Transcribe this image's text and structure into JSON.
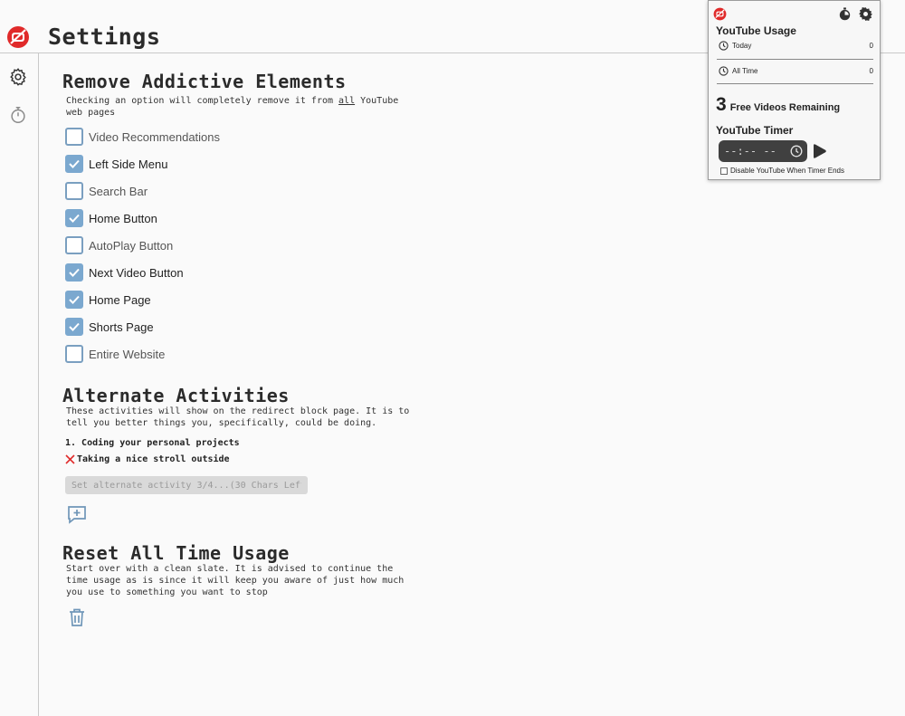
{
  "header": {
    "title": "Settings"
  },
  "colors": {
    "brand_red": "#e02a2a",
    "checkbox_blue": "#7ba8cf",
    "accent_icon": "#6f96b8"
  },
  "sidebar": {
    "items": [
      {
        "icon": "gear-icon"
      },
      {
        "icon": "stopwatch-icon"
      }
    ]
  },
  "remove": {
    "title": "Remove Addictive Elements",
    "desc_before": "Checking an option will completely remove it from ",
    "desc_emphasis": "all",
    "desc_after": " YouTube web pages",
    "options": [
      {
        "label": "Video Recommendations",
        "checked": false
      },
      {
        "label": "Left Side Menu",
        "checked": true
      },
      {
        "label": "Search Bar",
        "checked": false
      },
      {
        "label": "Home Button",
        "checked": true
      },
      {
        "label": "AutoPlay Button",
        "checked": false
      },
      {
        "label": "Next Video Button",
        "checked": true
      },
      {
        "label": "Home Page",
        "checked": true
      },
      {
        "label": "Shorts Page",
        "checked": true
      },
      {
        "label": "Entire Website",
        "checked": false
      }
    ]
  },
  "alternate": {
    "title": "Alternate Activities",
    "desc": "These activities will show on the redirect block page. It is to tell you better things you, specifically, could be doing.",
    "items": [
      "1. Coding your personal projects",
      "Taking a nice stroll outside"
    ],
    "input_placeholder": "Set alternate activity 3/4...(30 Chars Left)"
  },
  "reset": {
    "title": "Reset All Time Usage",
    "desc": "Start over with a clean slate. It is advised to continue the time usage as is since it will keep you aware of just how much you use to something you want to stop"
  },
  "popup": {
    "usage_title": "YouTube Usage",
    "today_label": "Today",
    "today_value": "0",
    "alltime_label": "All Time",
    "alltime_value": "0",
    "free_count": "3",
    "free_label": "Free Videos Remaining",
    "timer_title": "YouTube Timer",
    "timer_display": "--:-- --",
    "disable_label": "Disable YouTube When Timer Ends"
  }
}
